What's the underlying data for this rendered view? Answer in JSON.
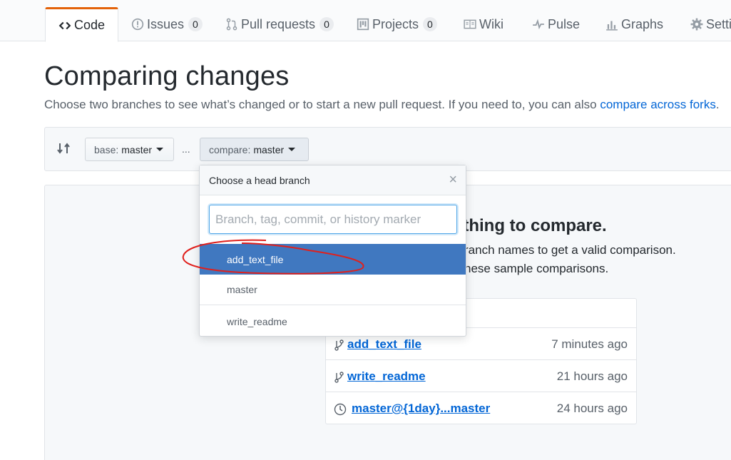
{
  "tabs": [
    {
      "label": "Code",
      "icon": "code-icon",
      "active": true
    },
    {
      "label": "Issues",
      "icon": "issue-icon",
      "count": "0"
    },
    {
      "label": "Pull requests",
      "icon": "pull-request-icon",
      "count": "0"
    },
    {
      "label": "Projects",
      "icon": "project-icon",
      "count": "0"
    },
    {
      "label": "Wiki",
      "icon": "book-icon"
    },
    {
      "label": "Pulse",
      "icon": "pulse-icon"
    },
    {
      "label": "Graphs",
      "icon": "graph-icon"
    },
    {
      "label": "Setti",
      "icon": "gear-icon"
    }
  ],
  "header": {
    "title": "Comparing changes",
    "description": "Choose two branches to see what’s changed or to start a new pull request. If you need to, you can also ",
    "link": "compare across forks",
    "link_suffix": "."
  },
  "range": {
    "base_prefix": "base:",
    "base_branch": "master",
    "separator": "...",
    "compare_prefix": "compare:",
    "compare_branch": "master"
  },
  "dropdown": {
    "title": "Choose a head branch",
    "close": "×",
    "filter_placeholder": "Branch, tag, commit, or history marker",
    "filter_value": "",
    "items": [
      "add_text_file",
      "master",
      "write_readme"
    ],
    "selected": "add_text_file"
  },
  "blankslate": {
    "title": "rthing to compare.",
    "line1": "ranch names to get a valid comparison.",
    "line2": "hese sample comparisons."
  },
  "samples": [
    {
      "label": "add_text_file",
      "time": "7 minutes ago",
      "icon": "branch-icon"
    },
    {
      "label": "write_readme",
      "time": "21 hours ago",
      "icon": "branch-icon"
    },
    {
      "label": "master@{1day}...master",
      "time": "24 hours ago",
      "icon": "history-icon"
    }
  ],
  "colors": {
    "accent_tab": "#e36209",
    "link": "#0366d6",
    "selected_item": "#4078c0",
    "annotation": "#e0201c"
  }
}
